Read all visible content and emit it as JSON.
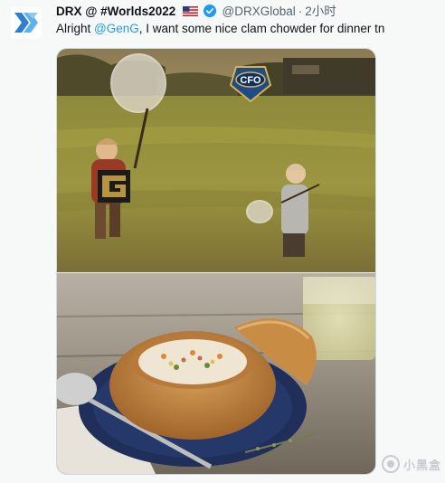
{
  "tweet": {
    "display_name": "DRX @ #Worlds2022",
    "handle": "@DRXGlobal",
    "separator": "·",
    "timestamp": "2小时",
    "text_before": "Alright ",
    "mention": "@GenG",
    "text_after": ", I want some nice clam chowder for dinner tn",
    "badge_text": "CFO"
  },
  "watermark": {
    "text": "小黑盒"
  },
  "icons": [
    "drx-logo-icon",
    "us-flag-icon",
    "verified-badge-icon",
    "geng-logo-icon",
    "cfo-logo-icon",
    "xiaoheihe-logo-icon"
  ],
  "colors": {
    "mention": "#1d9bf0",
    "verified": "#1d9bf0",
    "drx_blue": "#3a8fd8",
    "text_secondary": "#536471"
  }
}
